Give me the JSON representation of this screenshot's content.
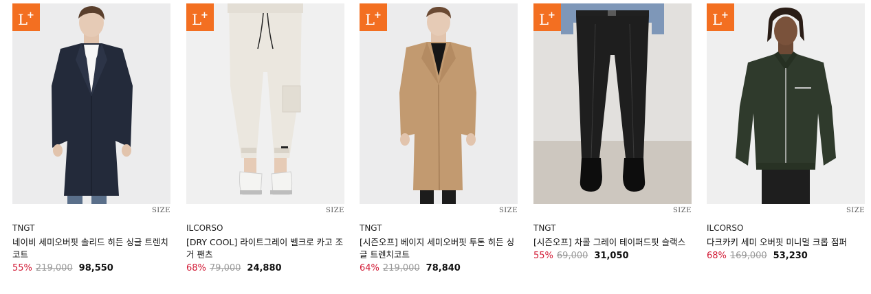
{
  "badge_text": "L",
  "badge_sup": "+",
  "size_label": "SIZE",
  "colors": {
    "badge": "#f36f21",
    "discount": "#d21b36",
    "original_price": "#999999"
  },
  "products": [
    {
      "brand": "TNGT",
      "name": "네이비 세미오버핏 솔리드 히든 싱글 트렌치코트",
      "discount": "55%",
      "original_price": "219,000",
      "sale_price": "98,550"
    },
    {
      "brand": "ILCORSO",
      "name": "[DRY COOL] 라이트그레이 벨크로 카고 조거 팬츠",
      "discount": "68%",
      "original_price": "79,000",
      "sale_price": "24,880"
    },
    {
      "brand": "TNGT",
      "name": "[시즌오프] 베이지 세미오버핏 투톤 히든 싱글 트렌치코트",
      "discount": "64%",
      "original_price": "219,000",
      "sale_price": "78,840"
    },
    {
      "brand": "TNGT",
      "name": "[시즌오프] 차콜 그레이 테이퍼드핏 슬랙스",
      "discount": "55%",
      "original_price": "69,000",
      "sale_price": "31,050"
    },
    {
      "brand": "ILCORSO",
      "name": "다크카키 세미 오버핏 미니멀 크롭 점퍼",
      "discount": "68%",
      "original_price": "169,000",
      "sale_price": "53,230"
    }
  ]
}
